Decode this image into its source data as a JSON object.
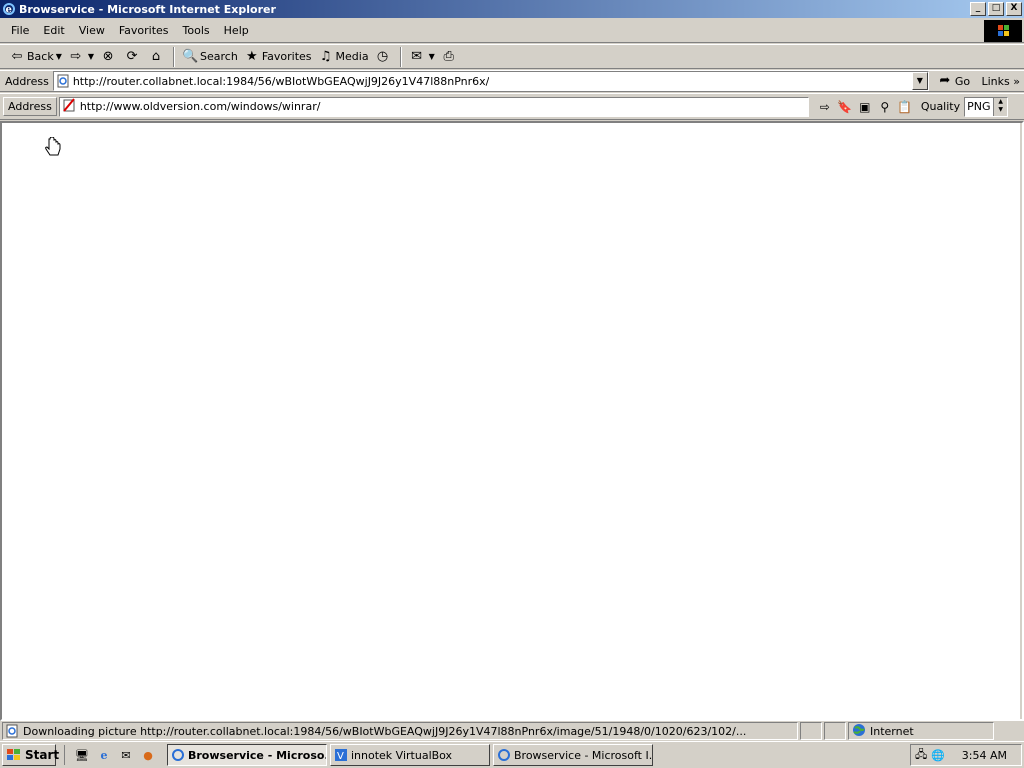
{
  "window": {
    "title": "Browservice - Microsoft Internet Explorer",
    "buttons": {
      "minimize": "_",
      "maximize": "□",
      "close": "X"
    }
  },
  "menubar": {
    "items": [
      "File",
      "Edit",
      "View",
      "Favorites",
      "Tools",
      "Help"
    ]
  },
  "toolbar": {
    "back": "Back",
    "search": "Search",
    "favorites": "Favorites",
    "media": "Media"
  },
  "address_bar": {
    "label": "Address",
    "url": "http://router.collabnet.local:1984/56/wBIotWbGEAQwjJ9J26y1V47l88nPnr6x/",
    "go_label": "Go",
    "links_label": "Links"
  },
  "browservice_bar": {
    "label": "Address",
    "url": "http://www.oldversion.com/windows/winrar/",
    "quality_label": "Quality",
    "quality_value": "PNG"
  },
  "statusbar": {
    "text": "Downloading picture http://router.collabnet.local:1984/56/wBIotWbGEAQwjJ9J26y1V47l88nPnr6x/image/51/1948/0/1020/623/102/...",
    "zone": "Internet"
  },
  "taskbar": {
    "start_label": "Start",
    "tasks": [
      {
        "label": "Browservice - Microso...",
        "active": true
      },
      {
        "label": "innotek VirtualBox",
        "active": false
      },
      {
        "label": "Browservice - Microsoft I...",
        "active": false
      }
    ],
    "clock": "3:54 AM"
  }
}
